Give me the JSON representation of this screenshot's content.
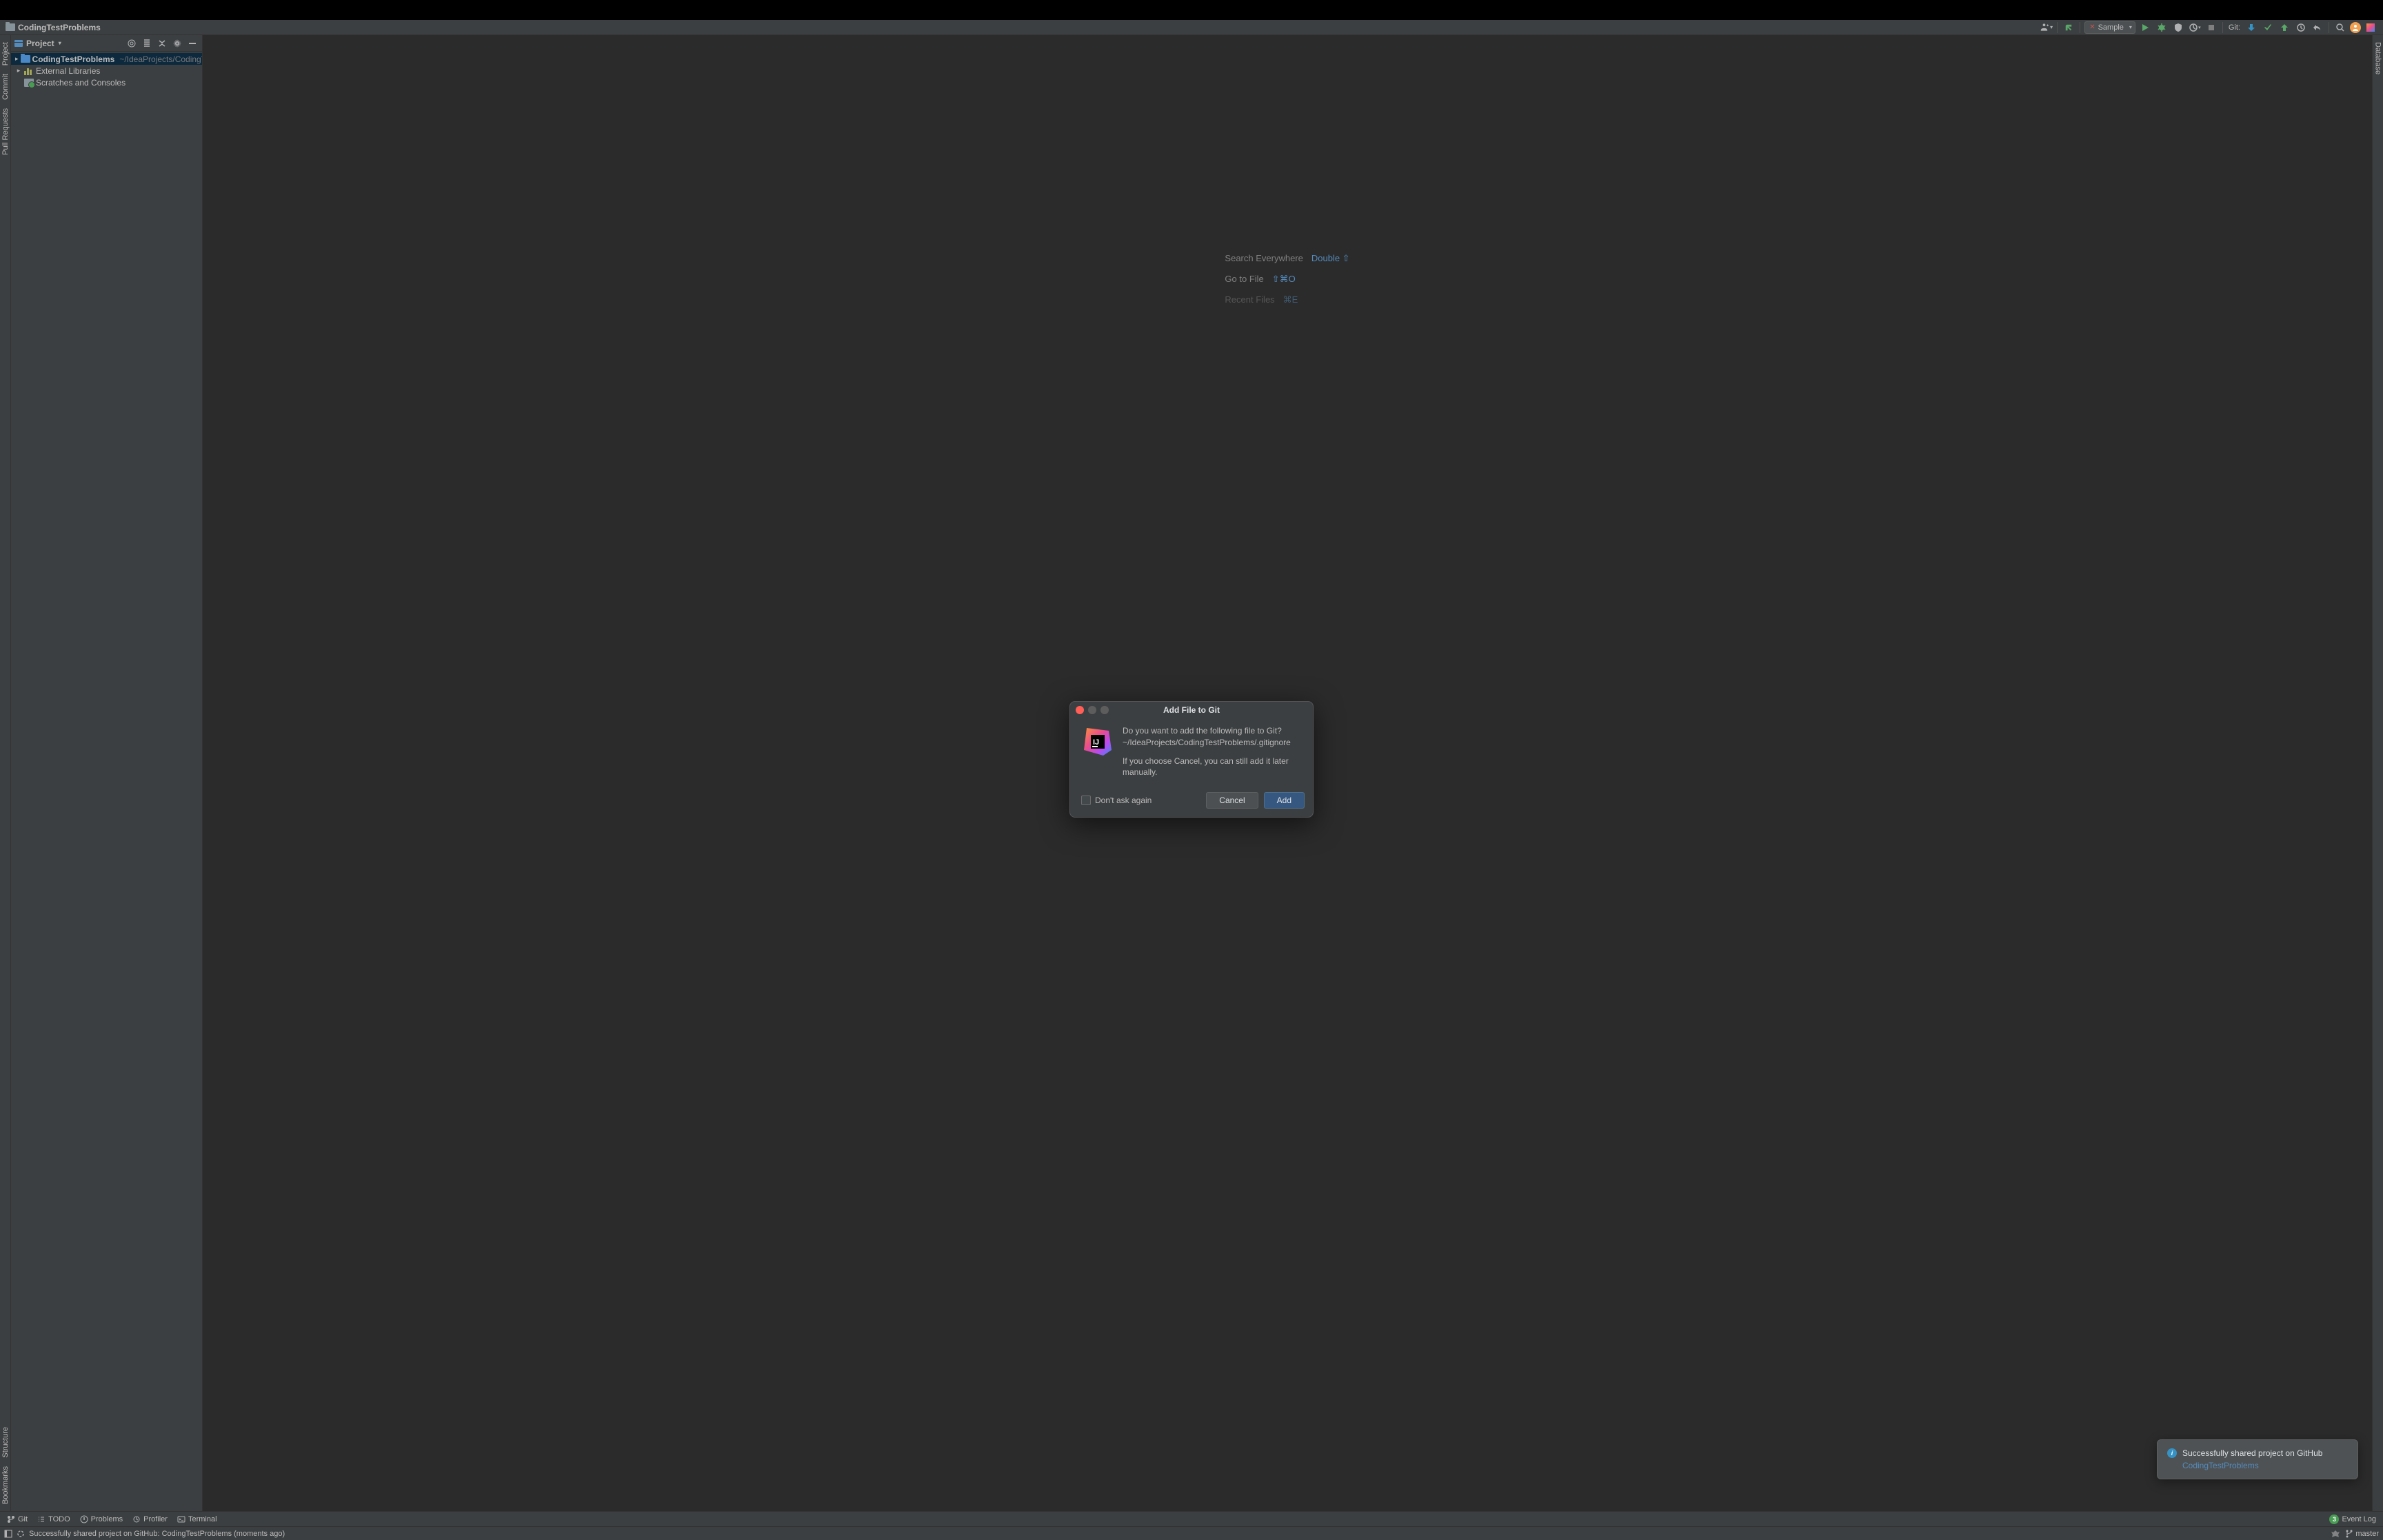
{
  "breadcrumb": {
    "project": "CodingTestProblems"
  },
  "toolbar": {
    "run_config": "Sample",
    "git_label": "Git:"
  },
  "sidebar_left": {
    "project": "Project",
    "commit": "Commit",
    "pull_requests": "Pull Requests",
    "structure": "Structure",
    "bookmarks": "Bookmarks"
  },
  "sidebar_right": {
    "database": "Database"
  },
  "project_panel": {
    "title": "Project",
    "tree": {
      "root": {
        "name": "CodingTestProblems",
        "path": "~/IdeaProjects/CodingTest"
      },
      "external_libs": "External Libraries",
      "scratches": "Scratches and Consoles"
    }
  },
  "welcome": {
    "search_label": "Search Everywhere",
    "search_shortcut": "Double ⇧",
    "goto_label": "Go to File",
    "goto_shortcut": "⇧⌘O",
    "recent_label": "Recent Files",
    "recent_shortcut": "⌘E"
  },
  "dialog": {
    "title": "Add File to Git",
    "line1": "Do you want to add the following file to Git?",
    "line2": "~/IdeaProjects/CodingTestProblems/.gitignore",
    "line3": "If you choose Cancel, you can still add it later manually.",
    "dont_ask": "Don't ask again",
    "cancel": "Cancel",
    "add": "Add"
  },
  "notification": {
    "title": "Successfully shared project on GitHub",
    "link": "CodingTestProblems"
  },
  "bottom_tabs": {
    "git": "Git",
    "todo": "TODO",
    "problems": "Problems",
    "profiler": "Profiler",
    "terminal": "Terminal",
    "event_log": "Event Log",
    "event_count": "3"
  },
  "status_bar": {
    "message": "Successfully shared project on GitHub: CodingTestProblems (moments ago)",
    "branch": "master"
  }
}
